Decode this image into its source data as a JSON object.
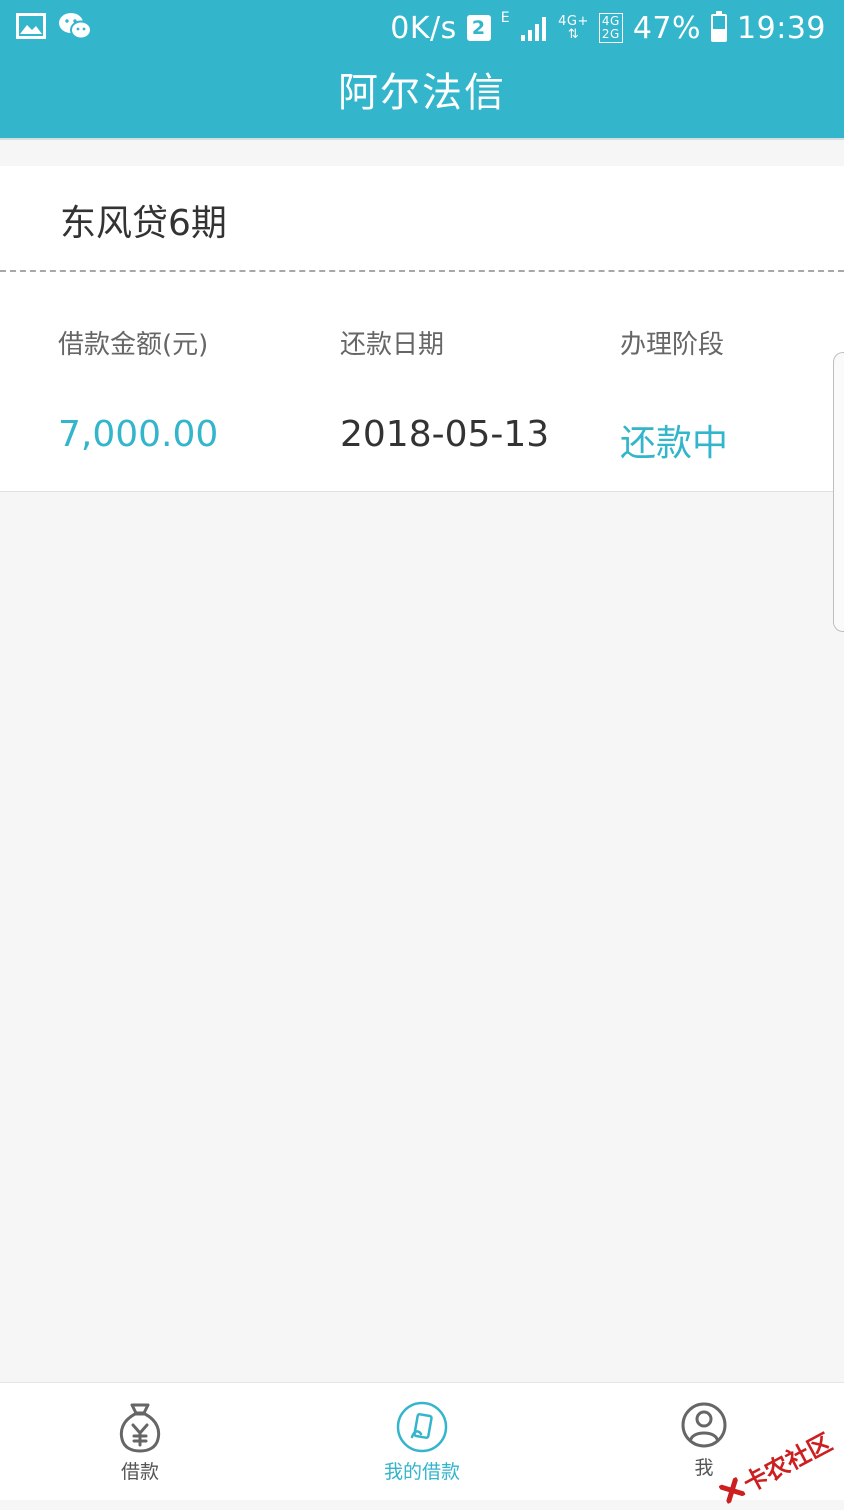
{
  "status_bar": {
    "net_speed": "0K/s",
    "sim_slot": "2",
    "network_e": "E",
    "network_4g_plus": "4G+",
    "network_4g": "4G",
    "network_2g": "2G",
    "battery_percent": "47%",
    "battery_level": 0.47,
    "time": "19:39"
  },
  "header": {
    "title": "阿尔法信"
  },
  "loan": {
    "product_name": "东风贷6期",
    "amount_label": "借款金额(元)",
    "amount_value": "7,000.00",
    "date_label": "还款日期",
    "date_value": "2018-05-13",
    "stage_label": "办理阶段",
    "stage_value": "还款中"
  },
  "bottom_nav": {
    "items": [
      {
        "label": "借款",
        "icon": "money-bag-icon",
        "active": false
      },
      {
        "label": "我的借款",
        "icon": "document-icon",
        "active": true
      },
      {
        "label": "我",
        "icon": "user-icon",
        "active": false
      }
    ]
  },
  "watermark": {
    "text": "卡农社区"
  },
  "colors": {
    "primary": "#33b5cc",
    "background": "#f6f6f6",
    "text": "#333333",
    "label": "#666666",
    "watermark": "#cc1f1f"
  }
}
